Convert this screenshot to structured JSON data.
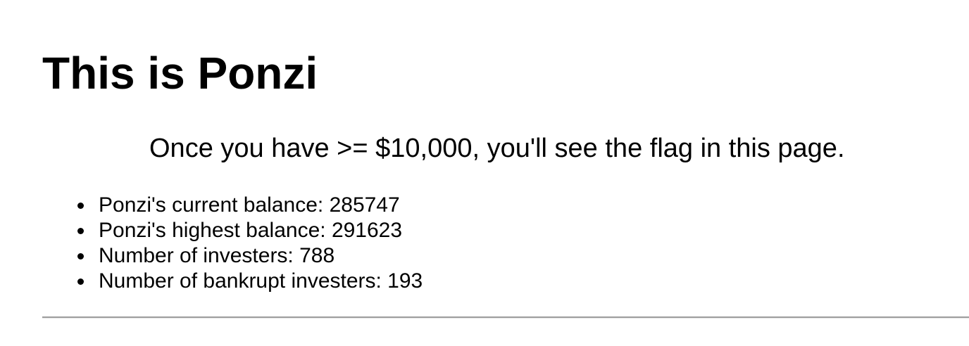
{
  "page": {
    "title": "This is Ponzi",
    "intro": "Once you have >= $10,000, you'll see the flag in this page."
  },
  "stats": [
    {
      "label": "Ponzi's current balance: 285747"
    },
    {
      "label": "Ponzi's highest balance: 291623"
    },
    {
      "label": "Number of investers: 788"
    },
    {
      "label": "Number of bankrupt investers: 193"
    }
  ],
  "colors": {
    "text": "#000000",
    "background": "#ffffff",
    "divider": "#9e9e9e"
  }
}
